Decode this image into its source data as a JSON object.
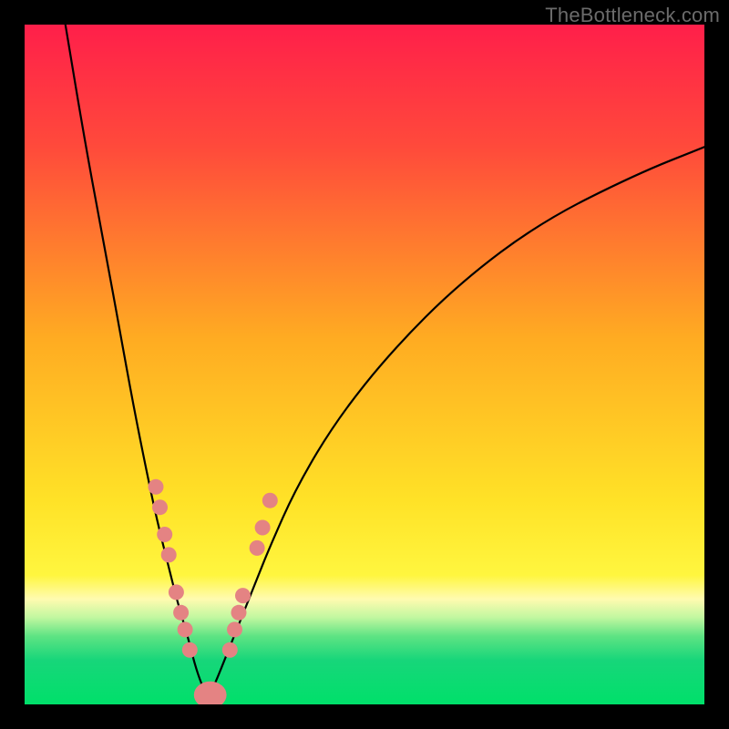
{
  "watermark": "TheBottleneck.com",
  "colors": {
    "frame": "#000000",
    "watermark_text": "#6b6b6b",
    "curve": "#000000",
    "marker": "#e48383",
    "gradient_stops": [
      {
        "offset": 0.0,
        "color": "#ff1f4a"
      },
      {
        "offset": 0.18,
        "color": "#ff4a3b"
      },
      {
        "offset": 0.46,
        "color": "#ffab22"
      },
      {
        "offset": 0.7,
        "color": "#ffe227"
      },
      {
        "offset": 0.81,
        "color": "#fff63f"
      },
      {
        "offset": 0.845,
        "color": "#fffbb0"
      },
      {
        "offset": 0.872,
        "color": "#c2f7a0"
      },
      {
        "offset": 0.9,
        "color": "#5de383"
      },
      {
        "offset": 0.935,
        "color": "#17d67a"
      },
      {
        "offset": 1.0,
        "color": "#00e06a"
      }
    ]
  },
  "chart_data": {
    "type": "line",
    "title": "",
    "xlabel": "",
    "ylabel": "",
    "xlim": [
      0,
      100
    ],
    "ylim": [
      0,
      100
    ],
    "series": [
      {
        "name": "left-branch",
        "x": [
          6,
          9,
          12,
          14,
          16,
          18,
          19.5,
          21,
          22.5,
          24,
          25,
          26,
          27
        ],
        "y": [
          100,
          82,
          66,
          55,
          44,
          34,
          27,
          21,
          15,
          10,
          6,
          3,
          1
        ]
      },
      {
        "name": "right-branch",
        "x": [
          27,
          28,
          30,
          32,
          34,
          36,
          40,
          46,
          54,
          64,
          76,
          90,
          100
        ],
        "y": [
          1,
          3,
          8,
          13,
          18,
          23,
          32,
          42,
          52,
          62,
          71,
          78,
          82
        ]
      }
    ],
    "markers_left": [
      {
        "x": 19.3,
        "y": 32
      },
      {
        "x": 19.9,
        "y": 29
      },
      {
        "x": 20.6,
        "y": 25
      },
      {
        "x": 21.2,
        "y": 22
      },
      {
        "x": 22.3,
        "y": 16.5
      },
      {
        "x": 23.0,
        "y": 13.5
      },
      {
        "x": 23.6,
        "y": 11
      },
      {
        "x": 24.3,
        "y": 8
      }
    ],
    "markers_right": [
      {
        "x": 30.2,
        "y": 8
      },
      {
        "x": 30.9,
        "y": 11
      },
      {
        "x": 31.5,
        "y": 13.5
      },
      {
        "x": 32.1,
        "y": 16
      },
      {
        "x": 34.2,
        "y": 23
      },
      {
        "x": 35.0,
        "y": 26
      },
      {
        "x": 36.1,
        "y": 30
      }
    ],
    "valley_blob": {
      "cx": 27.3,
      "cy": 1.4,
      "rx": 2.4,
      "ry": 2.0
    }
  }
}
